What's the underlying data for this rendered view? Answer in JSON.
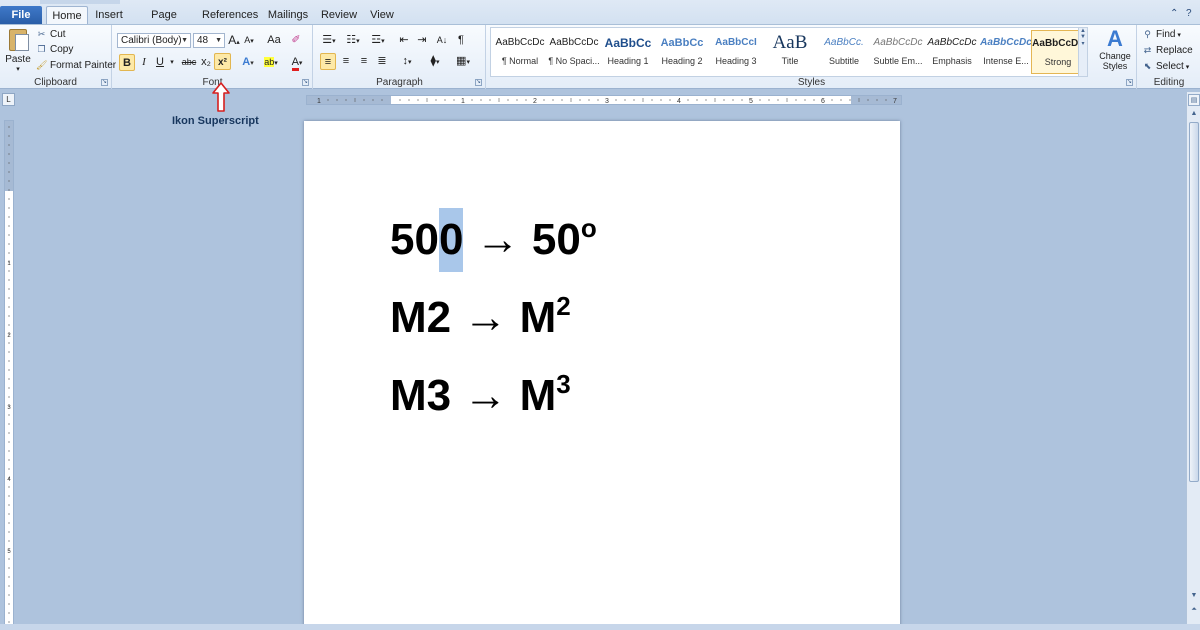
{
  "tabs": {
    "file": "File",
    "home": "Home",
    "insert": "Insert",
    "page_layout": "Page Layout",
    "references": "References",
    "mailings": "Mailings",
    "review": "Review",
    "view": "View"
  },
  "clipboard": {
    "paste": "Paste",
    "cut": "Cut",
    "copy": "Copy",
    "format_painter": "Format Painter",
    "label": "Clipboard"
  },
  "font": {
    "name": "Calibri (Body)",
    "size": "48",
    "label": "Font",
    "bold": "B",
    "italic": "I",
    "underline": "U",
    "strike": "abc",
    "subscript": "x₂",
    "superscript": "x²",
    "grow": "A",
    "shrink": "A",
    "change_case": "Aa",
    "text_effects": "A",
    "highlight": "ab",
    "font_color": "A"
  },
  "paragraph": {
    "label": "Paragraph",
    "pilcrow": "¶"
  },
  "styles": {
    "label": "Styles",
    "items": [
      {
        "sample": "AaBbCcDc",
        "name": "¶ Normal"
      },
      {
        "sample": "AaBbCcDc",
        "name": "¶ No Spaci..."
      },
      {
        "sample": "AaBbCc",
        "name": "Heading 1"
      },
      {
        "sample": "AaBbCc",
        "name": "Heading 2"
      },
      {
        "sample": "AaBbCcI",
        "name": "Heading 3"
      },
      {
        "sample": "AaB",
        "name": "Title"
      },
      {
        "sample": "AaBbCc.",
        "name": "Subtitle"
      },
      {
        "sample": "AaBbCcDc",
        "name": "Subtle Em..."
      },
      {
        "sample": "AaBbCcDc",
        "name": "Emphasis"
      },
      {
        "sample": "AaBbCcDc",
        "name": "Intense E..."
      },
      {
        "sample": "AaBbCcDc",
        "name": "Strong"
      }
    ],
    "change_styles": "Change Styles"
  },
  "editing": {
    "label": "Editing",
    "find": "Find",
    "replace": "Replace",
    "select": "Select"
  },
  "annotation": {
    "text": "Ikon Superscript"
  },
  "document": {
    "line1": {
      "a": "50",
      "sel": "0",
      "b": " → 50",
      "sup": "o"
    },
    "line2": {
      "a": "M2 → M",
      "sup": "2"
    },
    "line3": {
      "a": "M3 → M",
      "sup": "3"
    }
  },
  "ruler": {
    "h_labels": [
      "1",
      "1",
      "2",
      "3",
      "4",
      "5",
      "6",
      "7"
    ],
    "v_labels": [
      "1",
      "1",
      "2",
      "3",
      "4",
      "5"
    ]
  },
  "colors": {
    "file_tab": "#2a5ea8",
    "selection": "#a9c7ea",
    "highlight_button": "#fde9a7",
    "annotation_arrow": "#d61f1f"
  }
}
